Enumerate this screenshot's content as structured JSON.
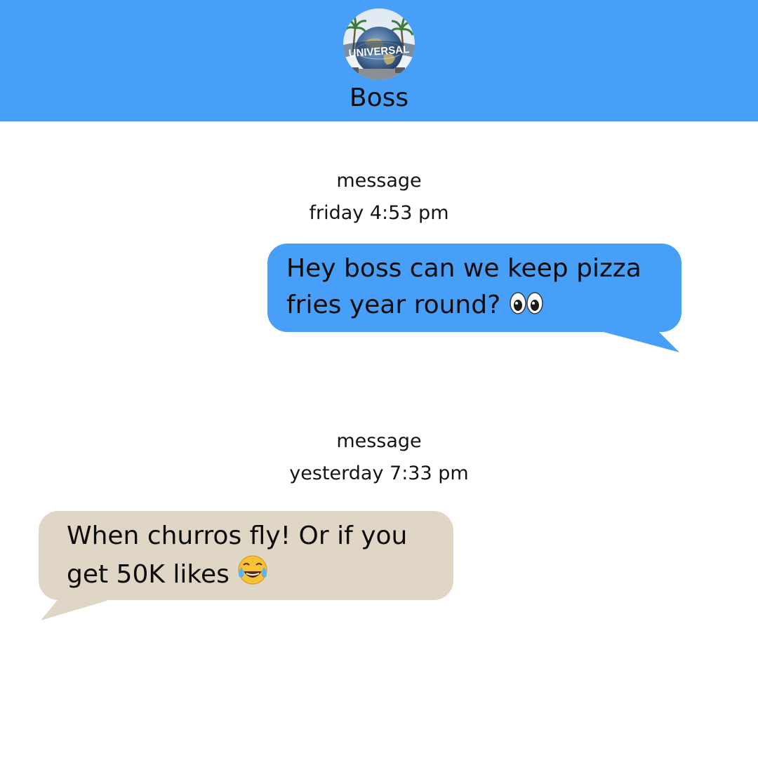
{
  "header": {
    "contact_name": "Boss",
    "avatar": {
      "icon": "universal-globe-avatar",
      "logo_text": "UNIVERSAL"
    },
    "background_color": "#479ff8"
  },
  "conversation": [
    {
      "label": "message",
      "timestamp": "friday 4:53 pm",
      "direction": "sent",
      "text_line1": "Hey boss can we keep pizza",
      "text_line2": "fries year round? ",
      "emoji": "eyes-emoji",
      "bubble_color": "#479ff8"
    },
    {
      "label": "message",
      "timestamp": "yesterday 7:33 pm",
      "direction": "received",
      "text_line1": "When churros fly! Or if you",
      "text_line2": "get 50K likes ",
      "emoji": "tears-of-joy-emoji",
      "bubble_color": "#e0d6c5"
    }
  ]
}
